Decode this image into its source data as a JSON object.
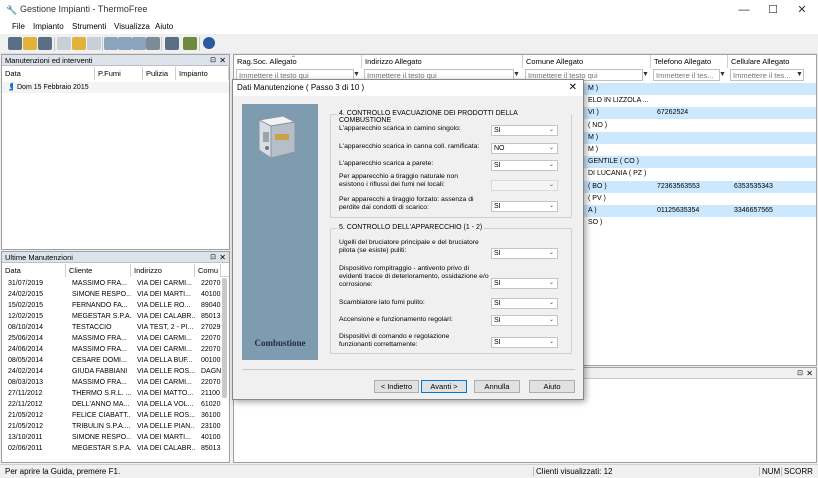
{
  "app": {
    "title": "Gestione Impianti - ThermoFree",
    "icon": "app-logo-icon"
  },
  "window_controls": {
    "minimize": "—",
    "maximize": "☐",
    "close": "✕"
  },
  "menu": [
    "File",
    "Impianto",
    "Strumenti",
    "Visualizza",
    "Aiuto"
  ],
  "toolbar_icons": [
    "list-icon",
    "open-folder-icon",
    "grid-icon",
    "document-icon",
    "folder-icon",
    "copy-icon",
    "search-icon",
    "refresh-icon",
    "export-icon",
    "print-icon",
    "report-icon",
    "tools-icon",
    "help-icon"
  ],
  "maint_panel": {
    "title": "Manutenzioni ed interventi",
    "columns": [
      "Data",
      "P.Fumi",
      "Pulizia",
      "Impianto"
    ],
    "rows": [
      "Dom 15 Febbraio 2015"
    ]
  },
  "last_panel": {
    "title": "Ultime Manutenzioni",
    "columns": [
      "Data",
      "Cliente",
      "Indirizzo",
      "Comu"
    ],
    "rows": [
      [
        "31/07/2019",
        "MASSIMO FRA...",
        "VIA DEI CARMI...",
        "22070"
      ],
      [
        "24/02/2015",
        "SIMONE RESPO...",
        "VIA DEI MARTI...",
        "40100"
      ],
      [
        "15/02/2015",
        "FERNANDO FA...",
        "VIA DELLE RO...",
        "89040"
      ],
      [
        "12/02/2015",
        "MEGESTAR S.P.A.",
        "VIA DEI CALABR...",
        "85013"
      ],
      [
        "08/10/2014",
        "TESTACCIO",
        "VIA TEST, 2 - PI...",
        "27029"
      ],
      [
        "25/06/2014",
        "MASSIMO FRA...",
        "VIA DEI CARMI...",
        "22070"
      ],
      [
        "24/06/2014",
        "MASSIMO FRA...",
        "VIA DEI CARMI...",
        "22070"
      ],
      [
        "08/05/2014",
        "CESARE DOMI...",
        "VIA DELLA BUF...",
        "00100"
      ],
      [
        "24/02/2014",
        "GIUDA FABBIANI",
        "VIA DELLE ROS...",
        "DAGN"
      ],
      [
        "08/03/2013",
        "MASSIMO FRA...",
        "VIA DEI CARMI...",
        "22070"
      ],
      [
        "27/11/2012",
        "THERMO S.R.L. ...",
        "VIA DEI MATTO...",
        "21100"
      ],
      [
        "22/11/2012",
        "DELL'ANNO MA...",
        "VIA DELLA VOL...",
        "61020"
      ],
      [
        "21/05/2012",
        "FELICE CIABATT...",
        "VIA DELLE ROS...",
        "36100"
      ],
      [
        "21/05/2012",
        "TRIBULIN S.P.A....",
        "VIA DELLE PIAN...",
        "23100"
      ],
      [
        "13/10/2011",
        "SIMONE RESPO...",
        "VIA DEI MARTI...",
        "40100"
      ],
      [
        "02/06/2011",
        "MEGESTAR S.P.A.",
        "VIA DEI CALABR...",
        "85013"
      ]
    ]
  },
  "client_grid": {
    "columns": [
      "Rag.Soc. Allegato",
      "Indirizzo Allegato",
      "Comune Allegato",
      "Telefono Allegato",
      "Cellulare Allegato"
    ],
    "filter_placeholders": [
      "Immettere il testo qui",
      "Immettere il testo qui",
      "Immettere il testo qui",
      "Immettere il tes...",
      "Immettere il tes..."
    ],
    "rows": [
      {
        "comune": "M )",
        "tel": "",
        "cell": ""
      },
      {
        "comune": "ELO IN LIZZOLA ...",
        "tel": "",
        "cell": ""
      },
      {
        "comune": "VI )",
        "tel": "67262524",
        "cell": ""
      },
      {
        "comune": "( NO )",
        "tel": "",
        "cell": ""
      },
      {
        "comune": "M )",
        "tel": "",
        "cell": ""
      },
      {
        "comune": "M )",
        "tel": "",
        "cell": ""
      },
      {
        "comune": "GENTILE ( CO )",
        "tel": "",
        "cell": ""
      },
      {
        "comune": "DI LUCANIA ( PZ )",
        "tel": "",
        "cell": ""
      },
      {
        "comune": "( BO )",
        "tel": "72363563553",
        "cell": "6353535343"
      },
      {
        "comune": "( PV )",
        "tel": "",
        "cell": ""
      },
      {
        "comune": "A )",
        "tel": "01125635354",
        "cell": "3346657565"
      },
      {
        "comune": "SO )",
        "tel": "",
        "cell": ""
      }
    ]
  },
  "dialog": {
    "title": "Dati Manutenzione ( Passo 3 di 10 )",
    "sidebar_title": "Combustione",
    "section4": {
      "title": "4. CONTROLLO EVACUAZIONE DEI PRODOTTI DELLA COMBUSTIONE",
      "items": [
        {
          "label": "L'apparecchio scarica in camino singolo:",
          "value": "SI"
        },
        {
          "label": "L'apparecchio scarica in canna coll. ramificata:",
          "value": "NO"
        },
        {
          "label": "L'apparecchio scarica a parete:",
          "value": "SI"
        },
        {
          "label": "Per apparecchio a tiraggio naturale non esistono i riflussi dei fumi nei locali:",
          "value": ""
        },
        {
          "label": "Per apparecchi a tiraggio forzato: assenza di perdite dai condotti di scarico:",
          "value": "SI"
        }
      ]
    },
    "section5": {
      "title": "5. CONTROLLO DELL'APPARECCHIO (1 - 2)",
      "items": [
        {
          "label": "Ugelli del bruciatore principale e del bruciatore pilota (se esiste) puliti:",
          "value": "SI"
        },
        {
          "label": "Dispositivo rompitraggio - antivento privo di evidenti tracce di deterioramento, ossidazione e/o corrosione:",
          "value": "SI"
        },
        {
          "label": "Scambiatore lato fumi pulito:",
          "value": "SI"
        },
        {
          "label": "Accensione e funzionamento regolari:",
          "value": "SI"
        },
        {
          "label": "Dispositivi di comando e regolazione funzionanti correttamente:",
          "value": "SI"
        }
      ]
    },
    "buttons": {
      "back": "< Indietro",
      "next": "Avanti >",
      "cancel": "Annulla",
      "help": "Aiuto"
    }
  },
  "status": {
    "help": "Per aprire la Guida, premere F1.",
    "clients": "Clienti visualizzati: 12",
    "num": "NUM",
    "scroll": "SCORR"
  },
  "colors": {
    "selected_row": "#cce8ff",
    "panel_header": "#dde3ea",
    "sidebar": "#7f9bb0",
    "default_button": "#0078d7"
  }
}
